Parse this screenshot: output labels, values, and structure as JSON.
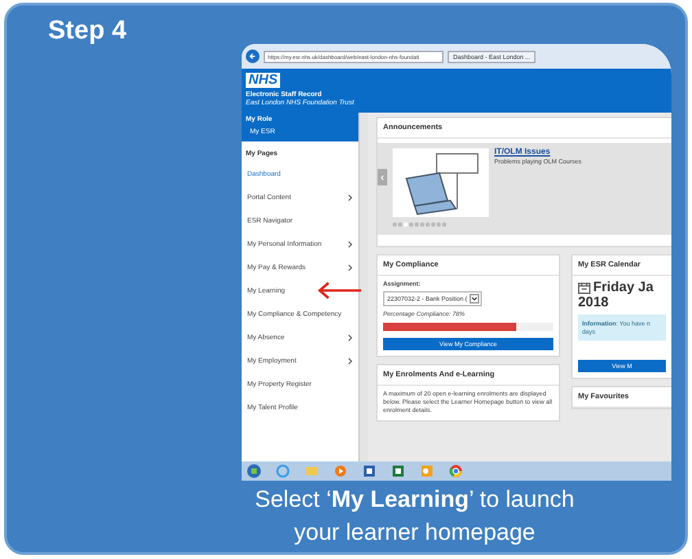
{
  "step_label": "Step 4",
  "browser": {
    "address": "https://my.esr.nhs.uk/dashboard/web/east-london-nhs-foundati",
    "tab": "Dashboard - East London ..."
  },
  "header": {
    "logo": "NHS",
    "title": "Electronic Staff Record",
    "subtitle": "East London NHS Foundation Trust"
  },
  "sidebar": {
    "role_heading": "My Role",
    "role_item": "My ESR",
    "pages_heading": "My Pages",
    "items": [
      {
        "label": "Dashboard",
        "selected": true,
        "has_submenu": false,
        "arrow": false
      },
      {
        "label": "Portal Content",
        "selected": false,
        "has_submenu": true,
        "arrow": false
      },
      {
        "label": "ESR Navigator",
        "selected": false,
        "has_submenu": false,
        "arrow": false
      },
      {
        "label": "My Personal Information",
        "selected": false,
        "has_submenu": true,
        "arrow": false
      },
      {
        "label": "My Pay & Rewards",
        "selected": false,
        "has_submenu": true,
        "arrow": false
      },
      {
        "label": "My Learning",
        "selected": false,
        "has_submenu": false,
        "arrow": true
      },
      {
        "label": "My Compliance & Competency",
        "selected": false,
        "has_submenu": false,
        "arrow": false
      },
      {
        "label": "My Absence",
        "selected": false,
        "has_submenu": true,
        "arrow": false
      },
      {
        "label": "My Employment",
        "selected": false,
        "has_submenu": true,
        "arrow": false
      },
      {
        "label": "My Property Register",
        "selected": false,
        "has_submenu": false,
        "arrow": false
      },
      {
        "label": "My Talent Profile",
        "selected": false,
        "has_submenu": false,
        "arrow": false
      }
    ]
  },
  "announcements": {
    "title": "Announcements",
    "link": "IT/OLM Issues",
    "description": "Problems playing OLM Courses",
    "dots": [
      {
        "selected": false
      },
      {
        "selected": false
      },
      {
        "selected": true
      },
      {
        "selected": false
      },
      {
        "selected": false
      },
      {
        "selected": false
      },
      {
        "selected": false
      },
      {
        "selected": false
      },
      {
        "selected": false
      },
      {
        "selected": false
      }
    ]
  },
  "compliance": {
    "title": "My Compliance",
    "assignment_label": "Assignment:",
    "assignment_value": "22307032-2 - Bank Position (",
    "percentage": "Percentage Compliance: 78%",
    "level": 0.78,
    "button": "View My Compliance"
  },
  "enrolments": {
    "title": "My Enrolments And e-Learning",
    "text": "A maximum of 20 open e-learning enrolments are displayed below. Please select the Learner Homepage button to view all enrolment details."
  },
  "calendar": {
    "title": "My ESR Calendar",
    "date": "Friday Ja",
    "year": "2018",
    "info": "**Information**: You have n",
    "info_2": "days",
    "button": "View M"
  },
  "favourites": {
    "title": "My Favourites"
  },
  "caption": "Select ‘**My Learning**’ to launch your learner homepage"
}
